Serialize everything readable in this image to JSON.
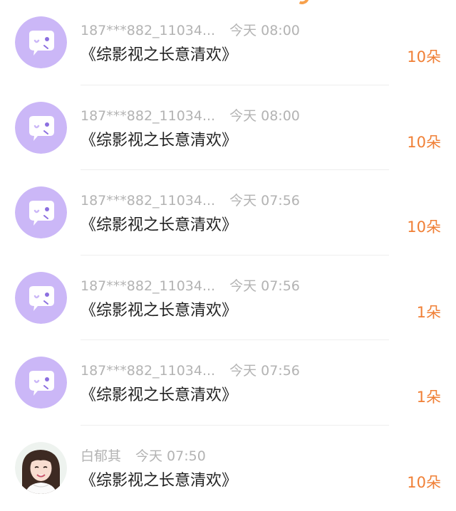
{
  "colors": {
    "accent_orange": "#f07f35",
    "muted_text": "#b3b3b3",
    "main_text": "#222222",
    "avatar_purple": "#cbb7f7"
  },
  "rows": [
    {
      "username": "187***882_11034...",
      "time": "今天 08:00",
      "title": "《综影视之长意清欢》",
      "count": "10朵",
      "avatar": "purple-chat-avatar-icon"
    },
    {
      "username": "187***882_11034...",
      "time": "今天 08:00",
      "title": "《综影视之长意清欢》",
      "count": "10朵",
      "avatar": "purple-chat-avatar-icon"
    },
    {
      "username": "187***882_11034...",
      "time": "今天 07:56",
      "title": "《综影视之长意清欢》",
      "count": "10朵",
      "avatar": "purple-chat-avatar-icon"
    },
    {
      "username": "187***882_11034...",
      "time": "今天 07:56",
      "title": "《综影视之长意清欢》",
      "count": "1朵",
      "avatar": "purple-chat-avatar-icon"
    },
    {
      "username": "187***882_11034...",
      "time": "今天 07:56",
      "title": "《综影视之长意清欢》",
      "count": "1朵",
      "avatar": "purple-chat-avatar-icon"
    },
    {
      "username": "白郁其",
      "time": "今天 07:50",
      "title": "《综影视之长意清欢》",
      "count": "10朵",
      "avatar": "user-photo-avatar"
    }
  ]
}
